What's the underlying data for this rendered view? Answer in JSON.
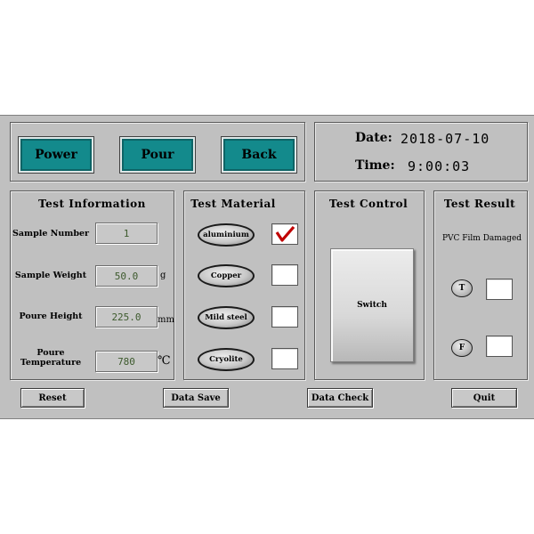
{
  "top_buttons": {
    "power": "Power",
    "pour": "Pour",
    "back": "Back"
  },
  "datetime": {
    "date_label": "Date:",
    "date_value": "2018-07-10",
    "time_label": "Time:",
    "time_value": "9:00:03"
  },
  "test_information": {
    "title": "Test Information",
    "sample_number_label": "Sample Number",
    "sample_number_value": "1",
    "sample_weight_label": "Sample Weight",
    "sample_weight_value": "50.0",
    "sample_weight_unit": "g",
    "poure_height_label": "Poure Height",
    "poure_height_value": "225.0",
    "poure_height_unit": "mm",
    "poure_temp_label_1": "Poure",
    "poure_temp_label_2": "Temperature",
    "poure_temp_value": "780",
    "poure_temp_unit": "℃"
  },
  "test_material": {
    "title": "Test Material",
    "items": [
      {
        "label": "aluminium",
        "checked": true
      },
      {
        "label": "Copper",
        "checked": false
      },
      {
        "label": "Mild steel",
        "checked": false
      },
      {
        "label": "Cryolite",
        "checked": false
      }
    ],
    "check_color": "#c00000"
  },
  "test_control": {
    "title": "Test Control",
    "switch_label": "Switch"
  },
  "test_result": {
    "title": "Test Result",
    "status": "PVC Film Damaged",
    "t_label": "T",
    "f_label": "F"
  },
  "bottom_buttons": {
    "reset": "Reset",
    "data_save": "Data Save",
    "data_check": "Data Check",
    "quit": "Quit"
  },
  "colors": {
    "teal": "#138a8c",
    "background": "#c0c0c0"
  }
}
